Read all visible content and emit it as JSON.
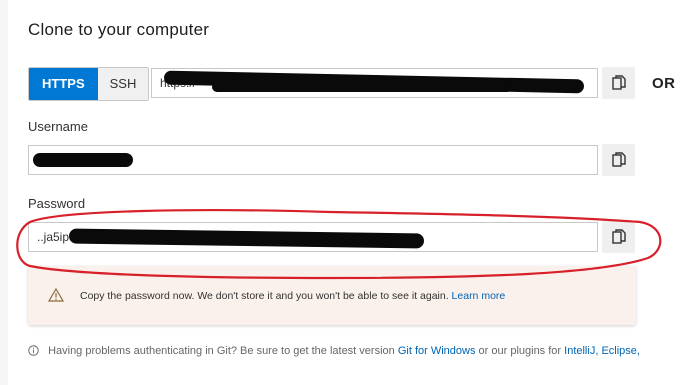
{
  "panel": {
    "title": "Clone to your computer"
  },
  "protocol": {
    "https_label": "HTTPS",
    "ssh_label": "SSH",
    "selected": "HTTPS"
  },
  "url_field": {
    "value": "https://"
  },
  "or_label": "OR",
  "username": {
    "label": "Username",
    "value": ""
  },
  "password": {
    "label": "Password",
    "value": "..ja5ipd26..."
  },
  "warning": {
    "text": "Copy the password now. We don't store it and you won't be able to see it again.",
    "link": "Learn more"
  },
  "footer": {
    "text_before": "Having problems authenticating in Git? Be sure to get the latest version",
    "link_git_windows": "Git for Windows",
    "text_middle": "or our plugins for",
    "link_intellij": "IntelliJ,",
    "link_eclipse": "Eclipse,"
  },
  "colors": {
    "accent": "#0078d4",
    "warning_bg": "#fbf1ec",
    "annotation_red": "#d7202a",
    "link": "#0064b4"
  },
  "icons": {
    "copy": "copy-icon",
    "warning": "warning-triangle-icon",
    "info": "info-circle-icon"
  }
}
